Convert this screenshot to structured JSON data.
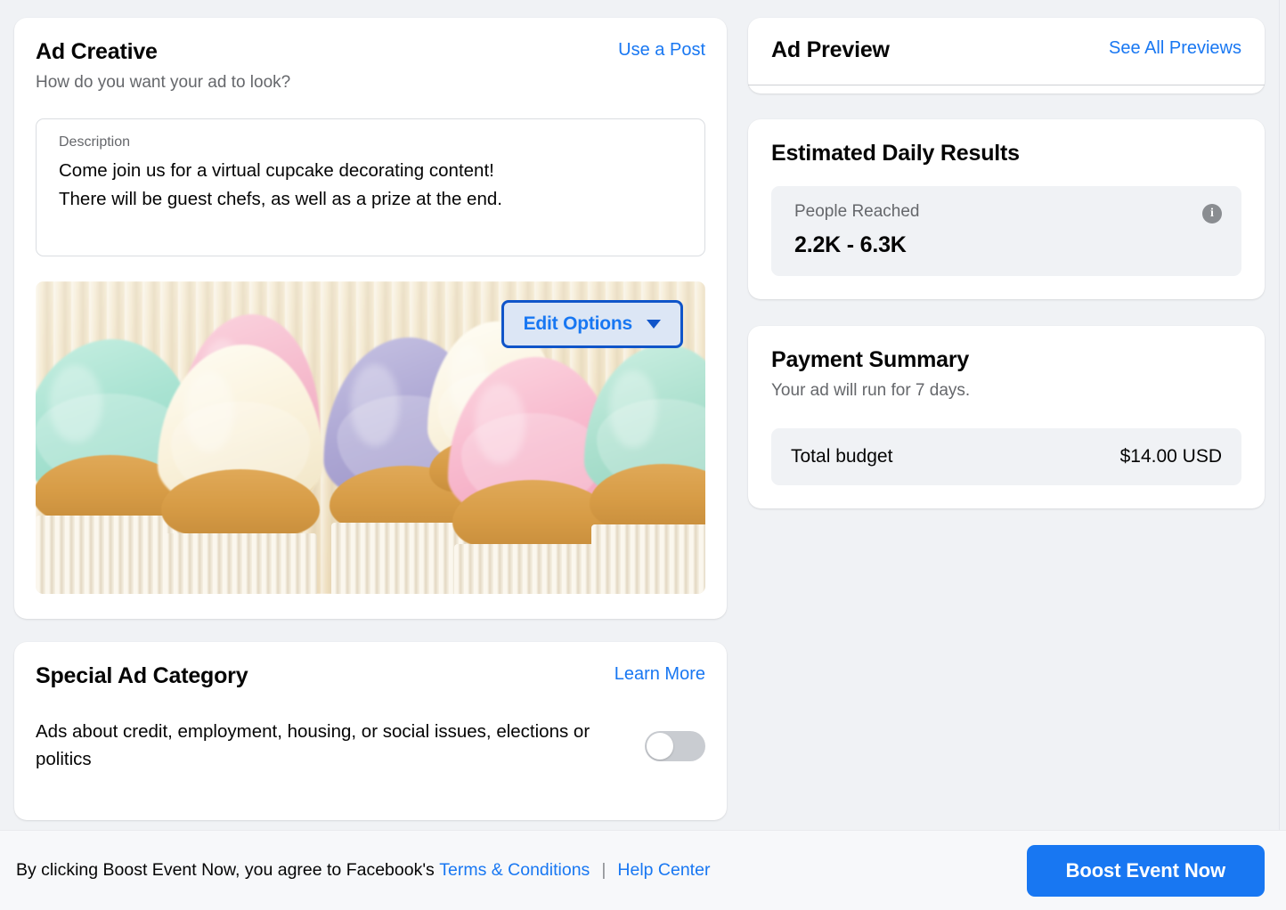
{
  "colors": {
    "accent": "#1877F2",
    "page_bg": "#F0F2F5",
    "card_bg": "#FFFFFF",
    "text_primary": "#050505",
    "text_secondary": "#65676B",
    "edit_button_border": "#1055C9",
    "edit_button_fill": "#DCE6F5",
    "toggle_off_track": "#C9CCD1"
  },
  "ad_creative": {
    "title": "Ad Creative",
    "subtitle": "How do you want your ad to look?",
    "use_a_post_label": "Use a Post",
    "description_label": "Description",
    "description_value": "Come join us for a virtual cupcake decorating content!\nThere will be guest chefs, as well as a prize at the end.",
    "edit_options_label": "Edit Options",
    "edit_options_icon": "chevron-down-icon",
    "media_alt": "Row of cupcakes with pastel mint, pink, cream and lavender frosting"
  },
  "special_ad_category": {
    "title": "Special Ad Category",
    "learn_more_label": "Learn More",
    "description": "Ads about credit, employment, housing, or social issues, elections or politics",
    "toggle_state": "off"
  },
  "ad_preview": {
    "title": "Ad Preview",
    "see_all_previews_label": "See All Previews"
  },
  "estimated_daily_results": {
    "title": "Estimated Daily Results",
    "metric_label": "People Reached",
    "metric_value": "2.2K - 6.3K",
    "info_icon": "info-icon",
    "info_glyph": "i"
  },
  "payment_summary": {
    "title": "Payment Summary",
    "subtitle": "Your ad will run for 7 days.",
    "budget_label": "Total budget",
    "budget_value": "$14.00 USD"
  },
  "footer": {
    "legal_prefix": "By clicking Boost Event Now, you agree to Facebook's",
    "terms_label": "Terms & Conditions",
    "separator": "|",
    "help_center_label": "Help Center",
    "primary_button_label": "Boost Event Now"
  }
}
